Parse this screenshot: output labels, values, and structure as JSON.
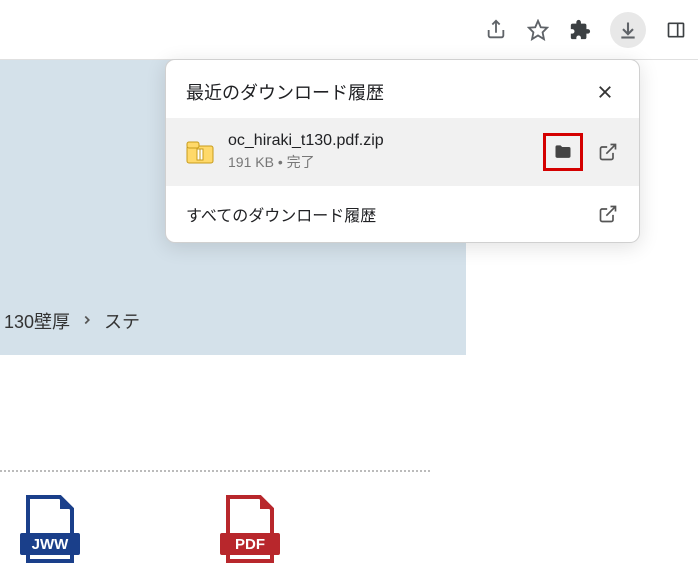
{
  "popup": {
    "title": "最近のダウンロード履歴",
    "item": {
      "filename": "oc_hiraki_t130.pdf.zip",
      "status": "191 KB • 完了"
    },
    "footer_label": "すべてのダウンロード履歴"
  },
  "breadcrumb": {
    "part1": "130壁厚",
    "part2": "ステ"
  },
  "files": {
    "jww_label": "JWW",
    "pdf_label": "PDF"
  }
}
